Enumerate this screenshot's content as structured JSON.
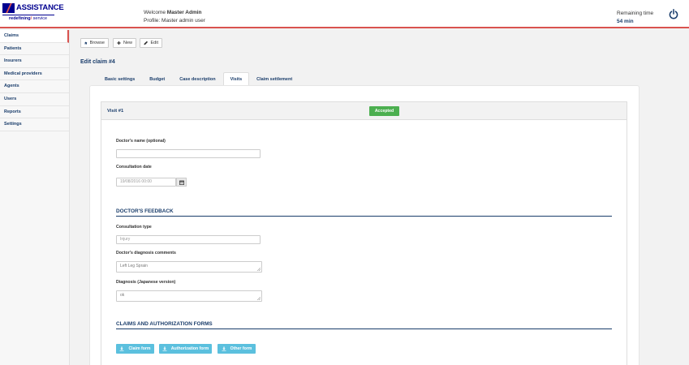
{
  "header": {
    "logo_text": "ASSISTANCE",
    "tagline_bold": "redefining",
    "tagline_slash": "/",
    "tagline_rest": " service",
    "welcome_prefix": "Welcome ",
    "welcome_name": "Master Admin",
    "profile_label": "Profile: Master admin user",
    "remaining_label": "Remaining time",
    "remaining_value": "54 min"
  },
  "sidebar": {
    "items": [
      {
        "label": "Claims"
      },
      {
        "label": "Patients"
      },
      {
        "label": "Insurers"
      },
      {
        "label": "Medical providers"
      },
      {
        "label": "Agents"
      },
      {
        "label": "Users"
      },
      {
        "label": "Reports"
      },
      {
        "label": "Settings"
      }
    ]
  },
  "toolbar": {
    "browse_label": "Browse",
    "new_label": "New",
    "edit_label": "Edit"
  },
  "page": {
    "title": "Edit claim #4"
  },
  "tabs": [
    {
      "label": "Basic settings"
    },
    {
      "label": "Budget"
    },
    {
      "label": "Case description"
    },
    {
      "label": "Visits"
    },
    {
      "label": "Claim settlement"
    }
  ],
  "visit": {
    "title": "Visit #1",
    "status": "Accepted",
    "colors": {
      "status": "#4caf50",
      "accent": "#1a3d6b",
      "header_rule": "#d9534f",
      "form_button": "#5bc0de"
    }
  },
  "form": {
    "doctor_name_label": "Doctor's name (optional)",
    "doctor_name_value": "",
    "consultation_date_label": "Consultation date",
    "consultation_date_value": "19/08/2016 00:00",
    "feedback_title": "DOCTOR'S FEEDBACK",
    "consultation_type_label": "Consultation type",
    "consultation_type_value": "Injury",
    "diagnosis_label": "Doctor's diagnosis comments",
    "diagnosis_value": "Left Leg Sprain",
    "diagnosis_jp_label": "Diagnosis (Japanese version)",
    "diagnosis_jp_value": "ok",
    "forms_title": "CLAIMS AND AUTHORIZATION FORMS",
    "claim_form_label": "Claim form",
    "authorization_form_label": "Authorization form",
    "other_form_label": "Other form"
  },
  "icons": {
    "logo": "axa-logo-icon",
    "power": "power-icon",
    "browse": "home-icon",
    "new": "plus-icon",
    "edit": "pencil-icon",
    "calendar": "calendar-icon",
    "download": "download-icon"
  }
}
